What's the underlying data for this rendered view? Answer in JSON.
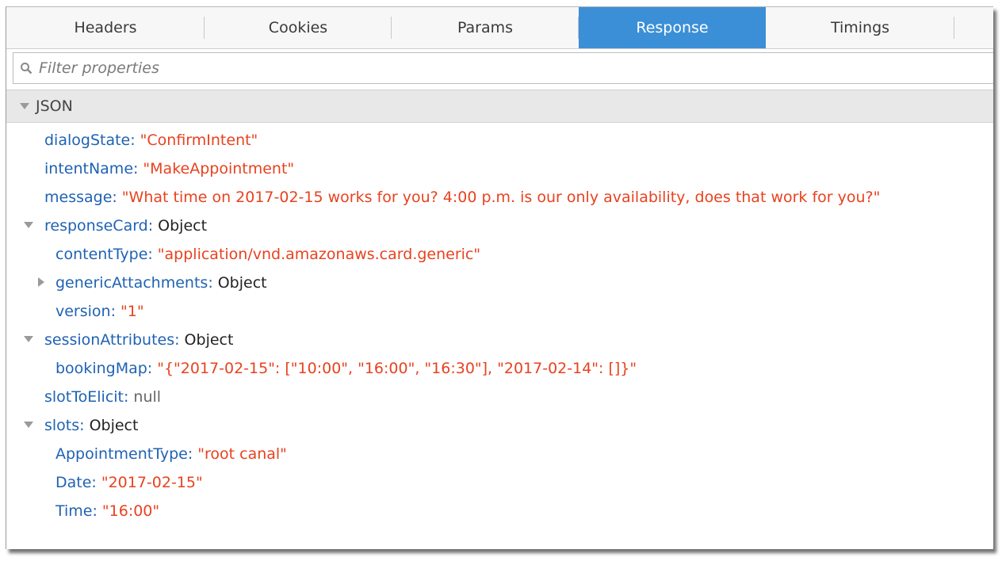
{
  "tabs": [
    {
      "label": "Headers",
      "active": false
    },
    {
      "label": "Cookies",
      "active": false
    },
    {
      "label": "Params",
      "active": false
    },
    {
      "label": "Response",
      "active": true
    },
    {
      "label": "Timings",
      "active": false
    }
  ],
  "filter": {
    "placeholder": "Filter properties",
    "icon": "search-icon"
  },
  "section": {
    "label": "JSON",
    "expanded": true
  },
  "tree": [
    {
      "key": "dialogState",
      "value": "\"ConfirmIntent\""
    },
    {
      "key": "intentName",
      "value": "\"MakeAppointment\""
    },
    {
      "key": "message",
      "value": "\"What time on 2017-02-15 works for you? 4:00 p.m. is our only availability, does that work for you?\""
    },
    {
      "key": "responseCard",
      "value": "Object",
      "expanded": true
    },
    {
      "key": "contentType",
      "value": "\"application/vnd.amazonaws.card.generic\""
    },
    {
      "key": "genericAttachments",
      "value": "Object",
      "expanded": false
    },
    {
      "key": "version",
      "value": "\"1\""
    },
    {
      "key": "sessionAttributes",
      "value": "Object",
      "expanded": true
    },
    {
      "key": "bookingMap",
      "value": "\"{\"2017-02-15\": [\"10:00\", \"16:00\", \"16:30\"], \"2017-02-14\": []}\""
    },
    {
      "key": "slotToElicit",
      "value": "null"
    },
    {
      "key": "slots",
      "value": "Object",
      "expanded": true
    },
    {
      "key": "AppointmentType",
      "value": "\"root canal\""
    },
    {
      "key": "Date",
      "value": "\"2017-02-15\""
    },
    {
      "key": "Time",
      "value": "\"16:00\""
    }
  ],
  "colors": {
    "accent": "#3b8fd6",
    "key": "#1f62b3",
    "string": "#e8421f"
  }
}
